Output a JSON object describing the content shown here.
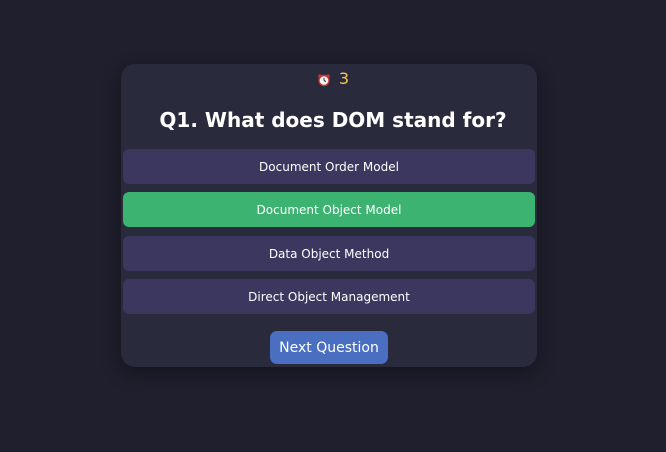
{
  "timer": {
    "icon": "alarm-clock-icon",
    "value": "3"
  },
  "question": {
    "text": "Q1. What does DOM stand for?"
  },
  "options": [
    {
      "label": "Document Order Model",
      "state": "default"
    },
    {
      "label": "Document Object Model",
      "state": "correct"
    },
    {
      "label": "Data Object Method",
      "state": "default"
    },
    {
      "label": "Direct Object Management",
      "state": "default"
    }
  ],
  "next_button": {
    "label": "Next Question"
  },
  "colors": {
    "background": "#1f1f2d",
    "card": "#2a2a3d",
    "option": "#3b375f",
    "correct": "#3cb371",
    "button": "#4a6fc0",
    "timer": "#f2c94c"
  }
}
